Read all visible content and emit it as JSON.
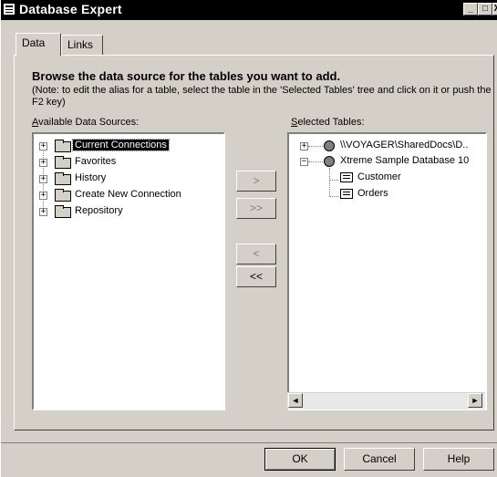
{
  "window": {
    "title": "Database Expert",
    "min_glyph": "_",
    "max_glyph": "□",
    "close_glyph": "X"
  },
  "tabs": [
    {
      "label": "Data",
      "active": true
    },
    {
      "label": "Links",
      "active": false
    }
  ],
  "heading": "Browse the data source for the tables you want to add.",
  "note": "(Note: to edit the alias for a table, select the table in the 'Selected Tables' tree and click on it or push the F2 key)",
  "available": {
    "label_hotkey": "A",
    "label_rest": "vailable Data Sources:",
    "items": [
      {
        "label": "Current Connections",
        "selected": true
      },
      {
        "label": "Favorites",
        "selected": false
      },
      {
        "label": "History",
        "selected": false
      },
      {
        "label": "Create New Connection",
        "selected": false
      },
      {
        "label": "Repository",
        "selected": false
      }
    ]
  },
  "selected": {
    "label_hotkey": "S",
    "label_rest": "elected Tables:",
    "items": [
      {
        "label": "\\\\VOYAGER\\SharedDocs\\D..",
        "expander": "+"
      },
      {
        "label": "Xtreme Sample Database 10",
        "expander": "-"
      },
      {
        "label": "Customer"
      },
      {
        "label": "Orders"
      }
    ]
  },
  "transfer_buttons": {
    "add_one": ">",
    "add_all": ">>",
    "remove_one": "<",
    "remove_all": "<<"
  },
  "scroll": {
    "left": "◄",
    "right": "►"
  },
  "dialog_buttons": {
    "ok": "OK",
    "cancel": "Cancel",
    "help": "Help"
  }
}
